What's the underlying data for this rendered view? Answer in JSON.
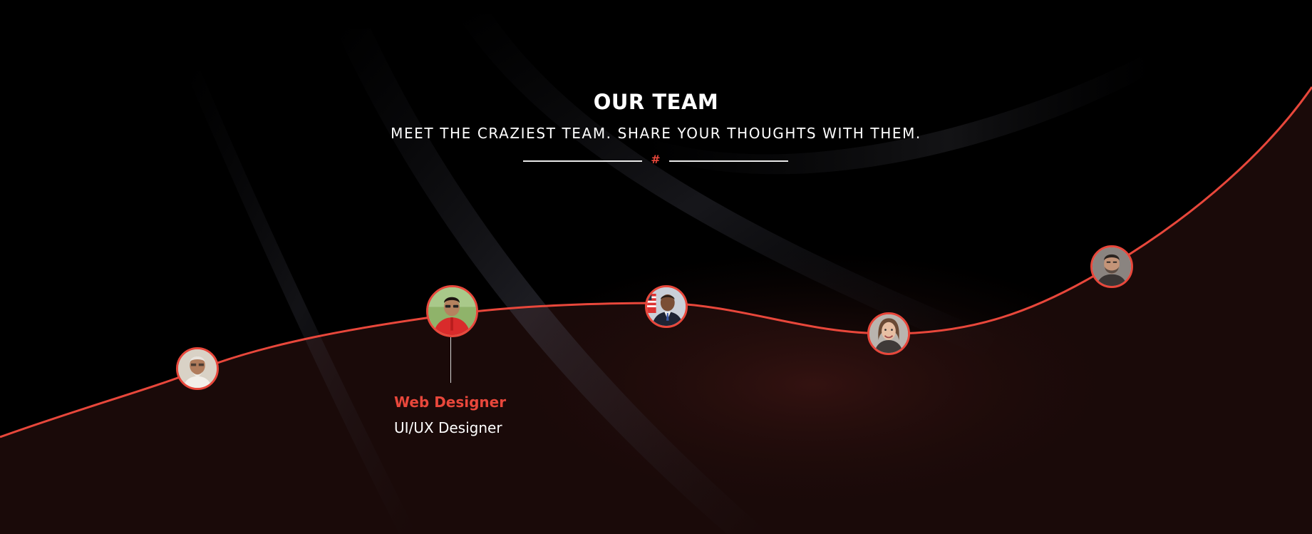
{
  "section": {
    "title": "OUR TEAM",
    "subtitle": "MEET THE CRAZIEST TEAM. SHARE YOUR THOUGHTS WITH THEM.",
    "divider_mark": "#"
  },
  "colors": {
    "accent": "#e8473b",
    "background": "#000000",
    "lower_background": "#1a0a09",
    "text": "#ffffff"
  },
  "team": {
    "members": [
      {
        "avatar_icon": "older-man-portrait"
      },
      {
        "avatar_icon": "young-man-red-shirt-portrait"
      },
      {
        "avatar_icon": "man-suit-flag-portrait"
      },
      {
        "avatar_icon": "woman-smiling-portrait"
      },
      {
        "avatar_icon": "bearded-man-portrait"
      }
    ],
    "active": {
      "role": "Web Designer",
      "title": "UI/UX Designer"
    }
  }
}
